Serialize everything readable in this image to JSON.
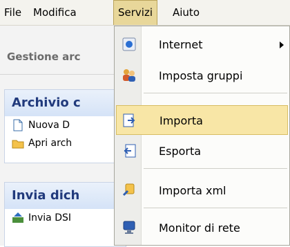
{
  "menubar": {
    "file": "File",
    "modifica": "Modifica",
    "servizi": "Servizi",
    "aiuto": "Aiuto"
  },
  "left_panel": {
    "toolbar_title": "Gestione arc",
    "archivio": {
      "title": "Archivio c",
      "items": [
        "Nuova D",
        "Apri arch"
      ]
    },
    "invia": {
      "title": "Invia dich",
      "items": [
        "Invia DSI"
      ]
    }
  },
  "dropdown": {
    "items": [
      {
        "label": "Internet",
        "icon": "globe-icon",
        "has_submenu": true
      },
      {
        "label": "Imposta gruppi",
        "icon": "users-group-icon"
      },
      {
        "label": "Importa",
        "icon": "import-icon",
        "highlighted": true
      },
      {
        "label": "Esporta",
        "icon": "export-icon"
      },
      {
        "label": "Importa xml",
        "icon": "import-xml-icon"
      },
      {
        "label": "Monitor di rete",
        "icon": "monitor-icon"
      }
    ]
  },
  "colors": {
    "menu_active": "#e8d79a",
    "highlight": "#f8e6a6",
    "group_title": "#213a7c"
  }
}
